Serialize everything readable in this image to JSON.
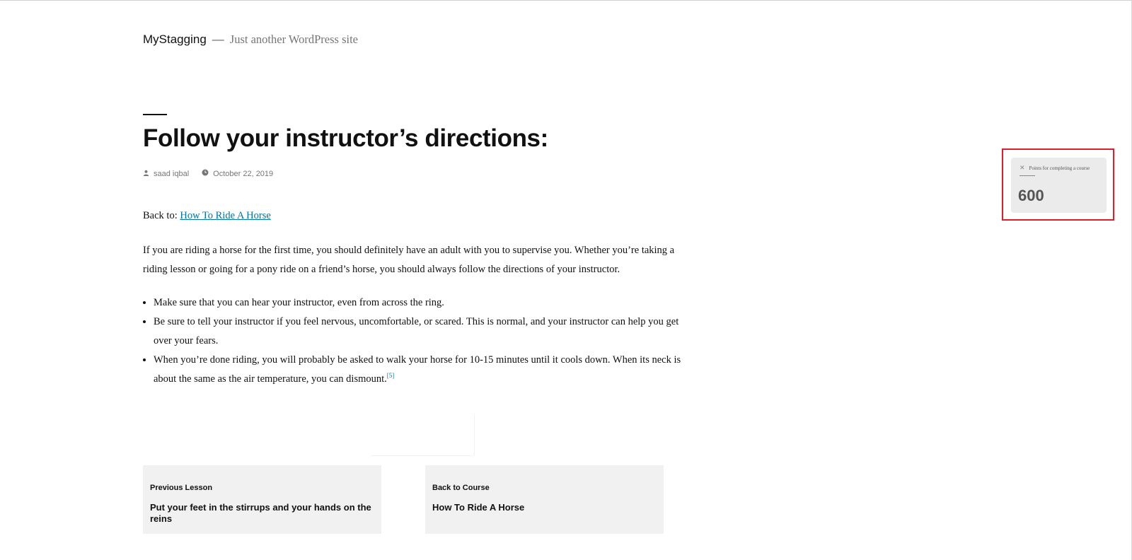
{
  "site": {
    "title": "MyStagging",
    "separator": "—",
    "description": "Just another WordPress site"
  },
  "post": {
    "title": "Follow your instructor’s directions:",
    "author": "saad iqbal",
    "date": "October 22, 2019",
    "author_icon": "user-icon",
    "date_icon": "clock-icon"
  },
  "content": {
    "back_prefix": "Back to:",
    "back_link": "How To Ride A Horse",
    "paragraph": "If you are riding a horse for the first time, you should definitely have an adult with you to supervise you. Whether you’re taking a riding lesson or going for a pony ride on a friend’s horse, you should always follow the directions of your instructor.",
    "bullets": [
      "Make sure that you can hear your instructor, even from across the ring.",
      "Be sure to tell your instructor if you feel nervous, uncomfortable, or scared. This is normal, and your instructor can help you get over your fears.",
      "When you’re done riding, you will probably be asked to walk your horse for 10-15 minutes until it cools down. When its neck is about the same as the air temperature, you can dismount."
    ],
    "footnote": "[5]"
  },
  "nav": {
    "prev_label": "Previous Lesson",
    "prev_title": "Put your feet in the stirrups and your hands on the reins",
    "course_label": "Back to Course",
    "course_title": "How To Ride A Horse"
  },
  "points_widget": {
    "close": "✕",
    "label": "Points for completing a course",
    "value": "600",
    "highlight_color": "#e51c23"
  }
}
